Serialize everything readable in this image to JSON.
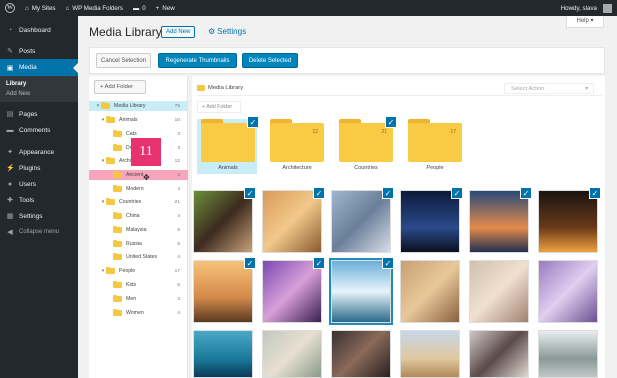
{
  "adminbar": {
    "sites": "My Sites",
    "site_name": "WP Media Folders",
    "comments_count": "0",
    "new_label": "New",
    "howdy": "Howdy, slava"
  },
  "sidebar": {
    "items": [
      {
        "label": "Dashboard",
        "icon": "dashboard-icon",
        "glyph": "◔"
      },
      {
        "label": "Posts",
        "icon": "pin-icon",
        "glyph": "✎"
      },
      {
        "label": "Media",
        "icon": "media-icon",
        "glyph": "▣"
      },
      {
        "label": "Pages",
        "icon": "pages-icon",
        "glyph": "▤"
      },
      {
        "label": "Comments",
        "icon": "comments-icon",
        "glyph": "▬"
      },
      {
        "label": "Appearance",
        "icon": "appearance-icon",
        "glyph": "✦"
      },
      {
        "label": "Plugins",
        "icon": "plugins-icon",
        "glyph": "⚡"
      },
      {
        "label": "Users",
        "icon": "users-icon",
        "glyph": "●"
      },
      {
        "label": "Tools",
        "icon": "tools-icon",
        "glyph": "✚"
      },
      {
        "label": "Settings",
        "icon": "settings-icon",
        "glyph": "▦"
      }
    ],
    "submenu": [
      "Library",
      "Add New"
    ],
    "collapse": "Collapse menu"
  },
  "header": {
    "title": "Media Library",
    "add_new": "Add New",
    "settings": "Settings",
    "help": "Help ▾"
  },
  "toolbar": {
    "cancel": "Cancel Selection",
    "regenerate": "Regenerate Thumbnails",
    "delete": "Delete Selected"
  },
  "tree": {
    "add_folder": "+ Add Folder",
    "rows": [
      {
        "label": "Media Library",
        "count": "75",
        "caret": "▾"
      },
      {
        "label": "Animals",
        "count": "10",
        "caret": "▾"
      },
      {
        "label": "Cats",
        "count": "3",
        "caret": ""
      },
      {
        "label": "Dogs",
        "count": "3",
        "caret": ""
      },
      {
        "label": "Architecture",
        "count": "12",
        "caret": "▾"
      },
      {
        "label": "Ancient",
        "count": "3",
        "caret": ""
      },
      {
        "label": "Modern",
        "count": "4",
        "caret": ""
      },
      {
        "label": "Countries",
        "count": "21",
        "caret": "▾"
      },
      {
        "label": "China",
        "count": "4",
        "caret": ""
      },
      {
        "label": "Malaysia",
        "count": "5",
        "caret": ""
      },
      {
        "label": "Russia",
        "count": "5",
        "caret": ""
      },
      {
        "label": "United States",
        "count": "4",
        "caret": ""
      },
      {
        "label": "People",
        "count": "17",
        "caret": "▾"
      },
      {
        "label": "Kids",
        "count": "6",
        "caret": ""
      },
      {
        "label": "Men",
        "count": "3",
        "caret": ""
      },
      {
        "label": "Women",
        "count": "4",
        "caret": ""
      }
    ],
    "drag_count": "11"
  },
  "main": {
    "breadcrumb": "Media Library",
    "select_action": "Select Action",
    "add_folder": "+ Add Folder",
    "folders": [
      {
        "name": "Animals",
        "count": "",
        "checked": true
      },
      {
        "name": "Architecture",
        "count": "12",
        "checked": false
      },
      {
        "name": "Countries",
        "count": "21",
        "checked": true
      },
      {
        "name": "People",
        "count": "17",
        "checked": false
      }
    ]
  },
  "colors": {
    "accent": "#0073aa",
    "sidebar": "#23282d",
    "folder": "#f9ca44",
    "highlight": "#e6326f"
  }
}
